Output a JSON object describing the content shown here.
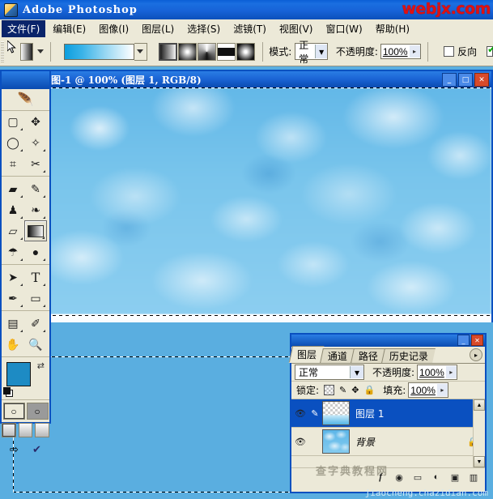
{
  "app": {
    "title": "Adobe Photoshop",
    "watermark": "webjx.com",
    "icon": "photoshop-icon"
  },
  "menubar": {
    "items": [
      {
        "label": "文件(F)",
        "selected": true
      },
      {
        "label": "编辑(E)",
        "selected": false
      },
      {
        "label": "图像(I)",
        "selected": false
      },
      {
        "label": "图层(L)",
        "selected": false
      },
      {
        "label": "选择(S)",
        "selected": false
      },
      {
        "label": "滤镜(T)",
        "selected": false
      },
      {
        "label": "视图(V)",
        "selected": false
      },
      {
        "label": "窗口(W)",
        "selected": false
      },
      {
        "label": "帮助(H)",
        "selected": false
      }
    ]
  },
  "options_bar": {
    "tool_preset_icon": "gradient-preset-icon",
    "gradient_picker_label": "gradient-preview",
    "gradient_types": [
      {
        "name": "linear-gradient-button",
        "selected": true
      },
      {
        "name": "radial-gradient-button",
        "selected": false
      },
      {
        "name": "angle-gradient-button",
        "selected": false
      },
      {
        "name": "reflected-gradient-button",
        "selected": false
      },
      {
        "name": "diamond-gradient-button",
        "selected": false
      }
    ],
    "mode_label": "模式:",
    "mode_value": "正常",
    "opacity_label": "不透明度:",
    "opacity_value": "100%",
    "reverse_label": "反向",
    "reverse_checked": false,
    "dither_checked": true
  },
  "document": {
    "title": "图-1 @ 100% (图层 1, RGB/8)",
    "zoom": "100%",
    "layer_in_title": "图层 1",
    "color_mode": "RGB/8",
    "minimize": "_",
    "maximize": "□",
    "close": "✕"
  },
  "toolbox": {
    "logo": "feather-logo",
    "tools": [
      {
        "name": "marquee-tool",
        "glyph": "▢",
        "selected": false
      },
      {
        "name": "move-tool",
        "glyph": "✥",
        "selected": false
      },
      {
        "name": "lasso-tool",
        "glyph": "◯",
        "selected": false
      },
      {
        "name": "magic-wand-tool",
        "glyph": "✧",
        "selected": false
      },
      {
        "name": "crop-tool",
        "glyph": "⌗",
        "selected": false
      },
      {
        "name": "slice-tool",
        "glyph": "✂",
        "selected": false
      },
      {
        "name": "healing-brush-tool",
        "glyph": "▰",
        "selected": false
      },
      {
        "name": "brush-tool",
        "glyph": "✎",
        "selected": false
      },
      {
        "name": "clone-stamp-tool",
        "glyph": "♟",
        "selected": false
      },
      {
        "name": "history-brush-tool",
        "glyph": "❧",
        "selected": false
      },
      {
        "name": "eraser-tool",
        "glyph": "▱",
        "selected": false
      },
      {
        "name": "gradient-tool",
        "glyph": "gradient",
        "selected": true
      },
      {
        "name": "blur-tool",
        "glyph": "☂",
        "selected": false
      },
      {
        "name": "dodge-tool",
        "glyph": "🗲",
        "selected": false
      },
      {
        "name": "path-selection-tool",
        "glyph": "➤",
        "selected": false
      },
      {
        "name": "type-tool",
        "glyph": "T",
        "selected": false
      },
      {
        "name": "pen-tool",
        "glyph": "✒",
        "selected": false
      },
      {
        "name": "shape-tool",
        "glyph": "▭",
        "selected": false
      },
      {
        "name": "notes-tool",
        "glyph": "🗒",
        "selected": false
      },
      {
        "name": "eyedropper-tool",
        "glyph": "✐",
        "selected": false
      },
      {
        "name": "hand-tool",
        "glyph": "✋",
        "selected": false
      },
      {
        "name": "zoom-tool",
        "glyph": "🔍",
        "selected": false
      }
    ],
    "foreground_color": "#1d8bc4",
    "background_color": "#ffffff",
    "swap_icon": "swap-colors-icon",
    "default_colors_icon": "default-colors-icon",
    "quickmask": [
      {
        "name": "standard-mode-button",
        "selected": true
      },
      {
        "name": "quick-mask-mode-button",
        "selected": false
      }
    ],
    "screen_modes": [
      {
        "name": "standard-screen-mode-button",
        "selected": true
      },
      {
        "name": "full-screen-menubar-mode-button",
        "selected": false
      },
      {
        "name": "full-screen-mode-button",
        "selected": false
      }
    ],
    "jump_to": [
      {
        "name": "jump-to-imageready-button"
      },
      {
        "name": "check-mark-button"
      }
    ]
  },
  "layers_panel": {
    "tabs": [
      {
        "label": "图层",
        "selected": true
      },
      {
        "label": "通道",
        "selected": false
      },
      {
        "label": "路径",
        "selected": false
      },
      {
        "label": "历史记录",
        "selected": false
      }
    ],
    "menu_icon": "panel-menu-icon",
    "blend_mode": "正常",
    "opacity_label": "不透明度:",
    "opacity_value": "100%",
    "lock_label": "锁定:",
    "lock_icons": [
      "lock-transparent-pixels-icon",
      "lock-image-pixels-icon",
      "lock-position-icon",
      "lock-all-icon"
    ],
    "fill_label": "填充:",
    "fill_value": "100%",
    "layers": [
      {
        "name": "图层 1",
        "visible": true,
        "selected": true,
        "linked_icon": "brush-indicator-icon",
        "locked": false,
        "thumb": "transparent-blue-gradient"
      },
      {
        "name": "背景",
        "visible": true,
        "selected": false,
        "linked_icon": "",
        "locked": true,
        "thumb": "cloud-texture"
      }
    ],
    "footer_buttons": [
      {
        "name": "layer-style-button",
        "glyph": "ƒ"
      },
      {
        "name": "layer-mask-button",
        "glyph": "◉"
      },
      {
        "name": "new-group-button",
        "glyph": "▭"
      },
      {
        "name": "adjustment-layer-button",
        "glyph": "◐"
      },
      {
        "name": "new-layer-button",
        "glyph": "▣"
      },
      {
        "name": "delete-layer-button",
        "glyph": "🗑"
      }
    ],
    "minimize": "_",
    "close": "✕",
    "overlay_watermark": "查字典教程网"
  },
  "footer": {
    "watermark": "jiaocheng.chazidian.com"
  }
}
